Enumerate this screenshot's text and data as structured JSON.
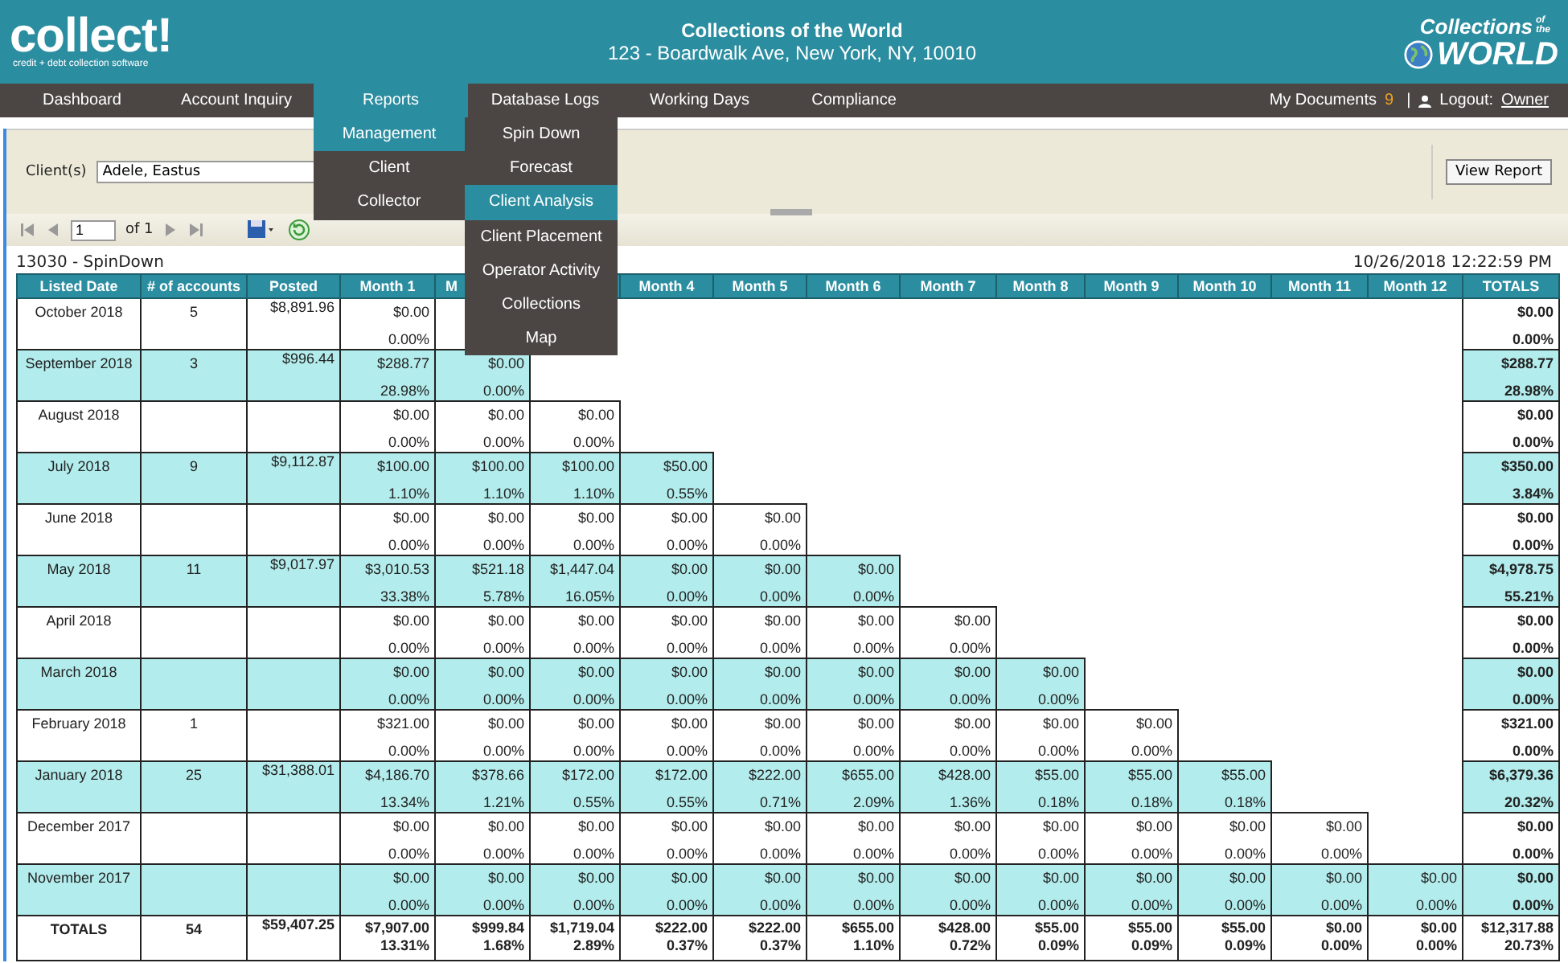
{
  "header": {
    "logo": "collect!",
    "logo_tagline": "credit + debt collection software",
    "company": "Collections of the World",
    "address": "123 - Boardwalk Ave, New York, NY, 10010",
    "brand": {
      "line1": "Collections",
      "small": "of the",
      "line2": "WORLD"
    }
  },
  "nav": {
    "items": [
      {
        "label": "Dashboard",
        "selected": false
      },
      {
        "label": "Account Inquiry",
        "selected": false
      },
      {
        "label": "Reports",
        "selected": true
      },
      {
        "label": "Database Logs",
        "selected": false
      },
      {
        "label": "Working Days",
        "selected": false
      },
      {
        "label": "Compliance",
        "selected": false
      }
    ],
    "documents_label": "My Documents",
    "documents_count": "9",
    "separator": "|",
    "logout_label": "Logout:",
    "user": "Owner"
  },
  "reports_menu": {
    "items": [
      {
        "label": "Management",
        "selected": true
      },
      {
        "label": "Client",
        "selected": false
      },
      {
        "label": "Collector",
        "selected": false
      }
    ],
    "submenu": [
      {
        "label": "Spin Down",
        "selected": false
      },
      {
        "label": "Forecast",
        "selected": false
      },
      {
        "label": "Client Analysis",
        "selected": true
      },
      {
        "label": "Client Placement",
        "selected": false
      },
      {
        "label": "Operator Activity",
        "selected": false
      },
      {
        "label": "Collections",
        "selected": false
      },
      {
        "label": "Map",
        "selected": false
      }
    ]
  },
  "parameters": {
    "client_label": "Client(s)",
    "client_value": "Adele, Eastus",
    "view_button": "View Report"
  },
  "pager": {
    "page": "1",
    "of": "of 1"
  },
  "report": {
    "title": "13030 - SpinDown",
    "timestamp": "10/26/2018 12:22:59 PM"
  },
  "table": {
    "columns": [
      {
        "label": "Listed Date"
      },
      {
        "label": "# of accounts"
      },
      {
        "label": "Posted"
      },
      {
        "label": "Month 1"
      },
      {
        "label": "M",
        "partly_covered": true
      },
      {},
      {
        "label": "Month 4"
      },
      {
        "label": "Month 5"
      },
      {
        "label": "Month 6"
      },
      {
        "label": "Month 7"
      },
      {
        "label": "Month 8"
      },
      {
        "label": "Month 9"
      },
      {
        "label": "Month 10"
      },
      {
        "label": "Month 11"
      },
      {
        "label": "Month 12"
      },
      {
        "label": "TOTALS"
      }
    ],
    "rows": [
      {
        "listed": "October 2018",
        "accounts": "5",
        "posted": "$8,891.96",
        "months": [
          [
            "$0.00",
            "0.00%"
          ]
        ],
        "total": [
          "$0.00",
          "0.00%"
        ]
      },
      {
        "listed": "September 2018",
        "accounts": "3",
        "posted": "$996.44",
        "months": [
          [
            "$288.77",
            "28.98%"
          ],
          [
            "$0.00",
            "0.00%"
          ]
        ],
        "total": [
          "$288.77",
          "28.98%"
        ]
      },
      {
        "listed": "August 2018",
        "months": [
          [
            "$0.00",
            "0.00%"
          ],
          [
            "$0.00",
            "0.00%"
          ],
          [
            "$0.00",
            "0.00%"
          ]
        ],
        "total": [
          "$0.00",
          "0.00%"
        ]
      },
      {
        "listed": "July 2018",
        "accounts": "9",
        "posted": "$9,112.87",
        "months": [
          [
            "$100.00",
            "1.10%"
          ],
          [
            "$100.00",
            "1.10%"
          ],
          [
            "$100.00",
            "1.10%"
          ],
          [
            "$50.00",
            "0.55%"
          ]
        ],
        "total": [
          "$350.00",
          "3.84%"
        ]
      },
      {
        "listed": "June 2018",
        "months": [
          [
            "$0.00",
            "0.00%"
          ],
          [
            "$0.00",
            "0.00%"
          ],
          [
            "$0.00",
            "0.00%"
          ],
          [
            "$0.00",
            "0.00%"
          ],
          [
            "$0.00",
            "0.00%"
          ]
        ],
        "total": [
          "$0.00",
          "0.00%"
        ]
      },
      {
        "listed": "May 2018",
        "accounts": "11",
        "posted": "$9,017.97",
        "months": [
          [
            "$3,010.53",
            "33.38%"
          ],
          [
            "$521.18",
            "5.78%"
          ],
          [
            "$1,447.04",
            "16.05%"
          ],
          [
            "$0.00",
            "0.00%"
          ],
          [
            "$0.00",
            "0.00%"
          ],
          [
            "$0.00",
            "0.00%"
          ]
        ],
        "total": [
          "$4,978.75",
          "55.21%"
        ]
      },
      {
        "listed": "April 2018",
        "months": [
          [
            "$0.00",
            "0.00%"
          ],
          [
            "$0.00",
            "0.00%"
          ],
          [
            "$0.00",
            "0.00%"
          ],
          [
            "$0.00",
            "0.00%"
          ],
          [
            "$0.00",
            "0.00%"
          ],
          [
            "$0.00",
            "0.00%"
          ],
          [
            "$0.00",
            "0.00%"
          ]
        ],
        "total": [
          "$0.00",
          "0.00%"
        ]
      },
      {
        "listed": "March 2018",
        "months": [
          [
            "$0.00",
            "0.00%"
          ],
          [
            "$0.00",
            "0.00%"
          ],
          [
            "$0.00",
            "0.00%"
          ],
          [
            "$0.00",
            "0.00%"
          ],
          [
            "$0.00",
            "0.00%"
          ],
          [
            "$0.00",
            "0.00%"
          ],
          [
            "$0.00",
            "0.00%"
          ],
          [
            "$0.00",
            "0.00%"
          ]
        ],
        "total": [
          "$0.00",
          "0.00%"
        ]
      },
      {
        "listed": "February 2018",
        "accounts": "1",
        "months": [
          [
            "$321.00",
            "0.00%"
          ],
          [
            "$0.00",
            "0.00%"
          ],
          [
            "$0.00",
            "0.00%"
          ],
          [
            "$0.00",
            "0.00%"
          ],
          [
            "$0.00",
            "0.00%"
          ],
          [
            "$0.00",
            "0.00%"
          ],
          [
            "$0.00",
            "0.00%"
          ],
          [
            "$0.00",
            "0.00%"
          ],
          [
            "$0.00",
            "0.00%"
          ]
        ],
        "total": [
          "$321.00",
          "0.00%"
        ]
      },
      {
        "listed": "January 2018",
        "accounts": "25",
        "posted": "$31,388.01",
        "months": [
          [
            "$4,186.70",
            "13.34%"
          ],
          [
            "$378.66",
            "1.21%"
          ],
          [
            "$172.00",
            "0.55%"
          ],
          [
            "$172.00",
            "0.55%"
          ],
          [
            "$222.00",
            "0.71%"
          ],
          [
            "$655.00",
            "2.09%"
          ],
          [
            "$428.00",
            "1.36%"
          ],
          [
            "$55.00",
            "0.18%"
          ],
          [
            "$55.00",
            "0.18%"
          ],
          [
            "$55.00",
            "0.18%"
          ]
        ],
        "total": [
          "$6,379.36",
          "20.32%"
        ]
      },
      {
        "listed": "December 2017",
        "months": [
          [
            "$0.00",
            "0.00%"
          ],
          [
            "$0.00",
            "0.00%"
          ],
          [
            "$0.00",
            "0.00%"
          ],
          [
            "$0.00",
            "0.00%"
          ],
          [
            "$0.00",
            "0.00%"
          ],
          [
            "$0.00",
            "0.00%"
          ],
          [
            "$0.00",
            "0.00%"
          ],
          [
            "$0.00",
            "0.00%"
          ],
          [
            "$0.00",
            "0.00%"
          ],
          [
            "$0.00",
            "0.00%"
          ],
          [
            "$0.00",
            "0.00%"
          ]
        ],
        "total": [
          "$0.00",
          "0.00%"
        ]
      },
      {
        "listed": "November 2017",
        "months": [
          [
            "$0.00",
            "0.00%"
          ],
          [
            "$0.00",
            "0.00%"
          ],
          [
            "$0.00",
            "0.00%"
          ],
          [
            "$0.00",
            "0.00%"
          ],
          [
            "$0.00",
            "0.00%"
          ],
          [
            "$0.00",
            "0.00%"
          ],
          [
            "$0.00",
            "0.00%"
          ],
          [
            "$0.00",
            "0.00%"
          ],
          [
            "$0.00",
            "0.00%"
          ],
          [
            "$0.00",
            "0.00%"
          ],
          [
            "$0.00",
            "0.00%"
          ],
          [
            "$0.00",
            "0.00%"
          ]
        ],
        "total": [
          "$0.00",
          "0.00%"
        ]
      }
    ],
    "totals": {
      "label": "TOTALS",
      "accounts": "54",
      "posted": "$59,407.25",
      "months": [
        [
          "$7,907.00",
          "13.31%"
        ],
        [
          "$999.84",
          "1.68%"
        ],
        [
          "$1,719.04",
          "2.89%"
        ],
        [
          "$222.00",
          "0.37%"
        ],
        [
          "$222.00",
          "0.37%"
        ],
        [
          "$655.00",
          "1.10%"
        ],
        [
          "$428.00",
          "0.72%"
        ],
        [
          "$55.00",
          "0.09%"
        ],
        [
          "$55.00",
          "0.09%"
        ],
        [
          "$55.00",
          "0.09%"
        ],
        [
          "$0.00",
          "0.00%"
        ],
        [
          "$0.00",
          "0.00%"
        ]
      ],
      "total": [
        "$12,317.88",
        "20.73%"
      ]
    }
  }
}
